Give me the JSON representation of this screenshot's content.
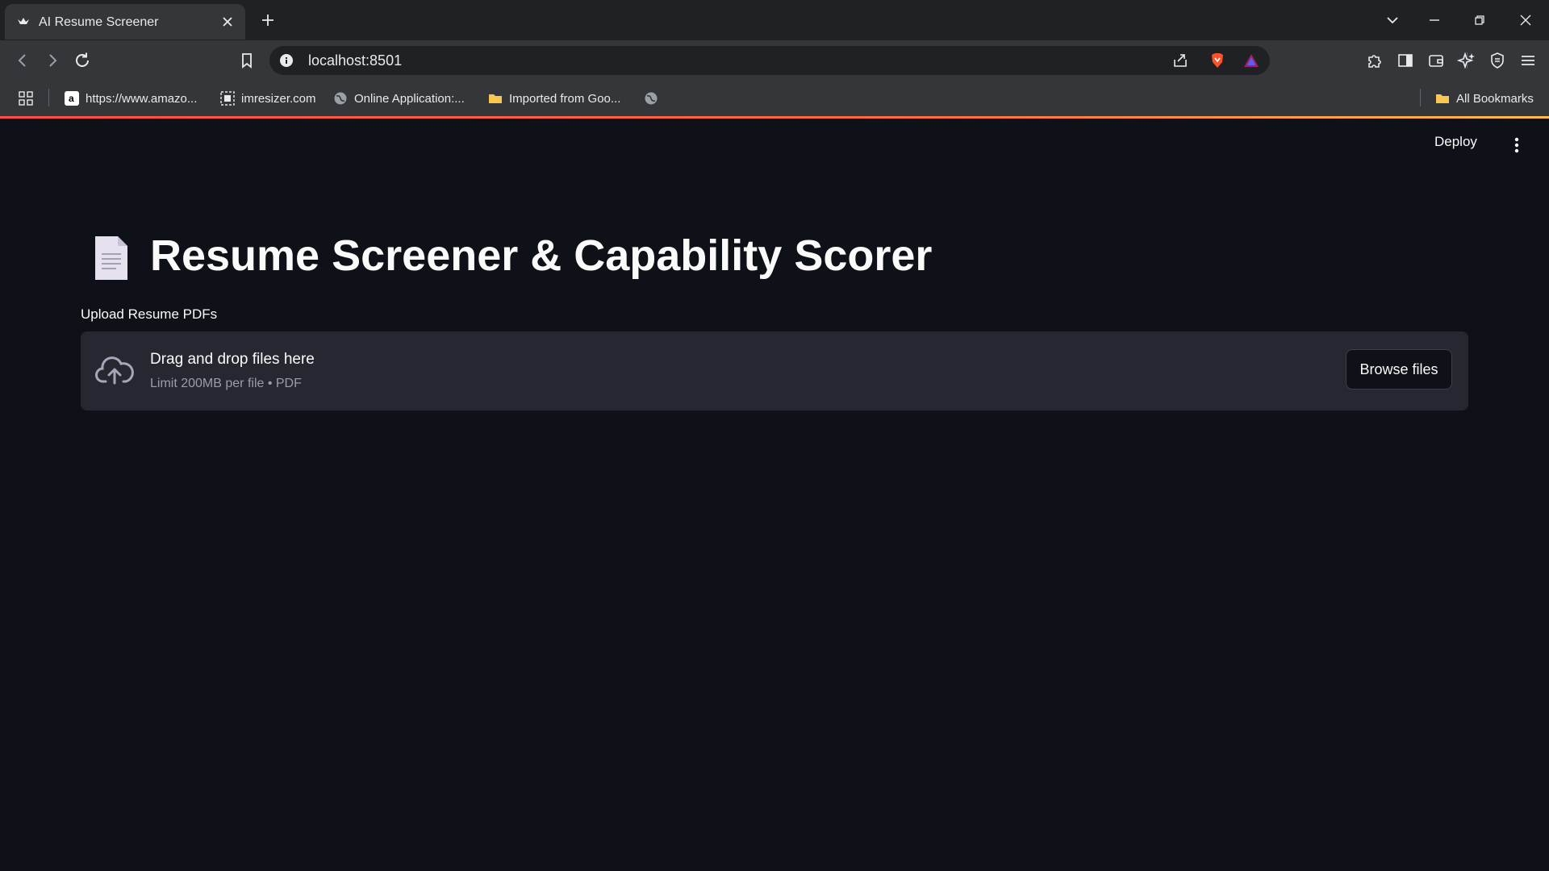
{
  "browser": {
    "tab_title": "AI Resume Screener",
    "url": "localhost:8501",
    "bookmarks": [
      {
        "label": "https://www.amazo...",
        "icon": "amazon-icon"
      },
      {
        "label": "imresizer.com",
        "icon": "imresizer-icon"
      },
      {
        "label": "Online Application:...",
        "icon": "globe-icon"
      },
      {
        "label": "Imported from Goo...",
        "icon": "folder-icon"
      },
      {
        "label": "",
        "icon": "globe-icon"
      }
    ],
    "all_bookmarks": "All Bookmarks"
  },
  "app": {
    "deploy_label": "Deploy",
    "title": "Resume Screener & Capability Scorer",
    "title_icon": "document-icon",
    "uploader": {
      "label": "Upload Resume PDFs",
      "drop_text": "Drag and drop files here",
      "limit_text": "Limit 200MB per file • PDF",
      "browse_label": "Browse files"
    }
  },
  "colors": {
    "app_bg": "#0e1117",
    "dropzone_bg": "#262730",
    "accent": "#ff4b4b"
  }
}
